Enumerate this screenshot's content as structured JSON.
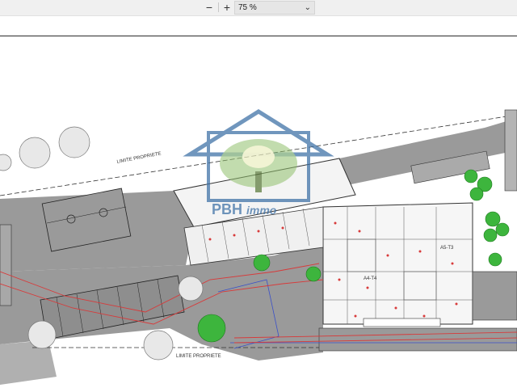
{
  "toolbar": {
    "zoom_out_label": "−",
    "zoom_in_label": "+",
    "zoom_value": "75 %"
  },
  "plan": {
    "property_limit_top": "LIMITE PROPRIETE",
    "property_limit_bottom": "LIMITE PROPRIETE",
    "unit_label_a4": "A4-T4",
    "unit_label_a5": "A5-T3"
  },
  "watermark": {
    "brand_primary": "PBH",
    "brand_secondary": "immo"
  },
  "colors": {
    "toolbar_bg": "#f0f0f0",
    "watermark_blue": "#3a6ea5",
    "parking_gray": "#9a9a9a",
    "tree_green": "#3db53d",
    "pipe_red": "#d83a3a"
  }
}
